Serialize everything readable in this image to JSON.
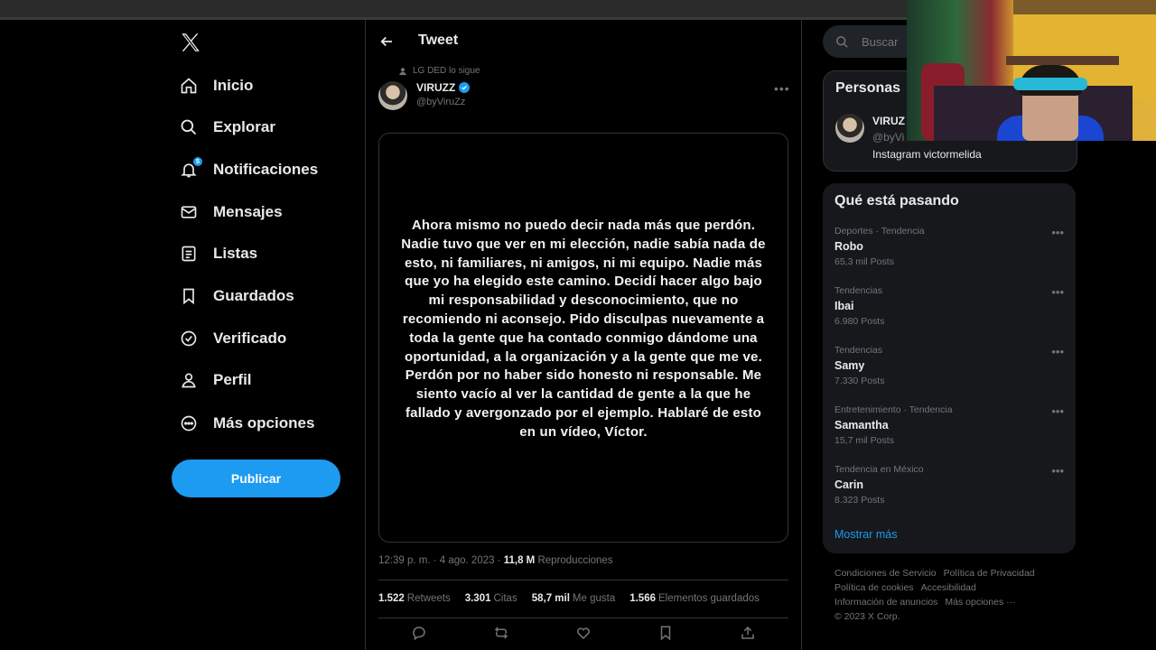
{
  "nav": {
    "items": [
      {
        "label": "Inicio",
        "icon": "home-icon"
      },
      {
        "label": "Explorar",
        "icon": "search-icon"
      },
      {
        "label": "Notificaciones",
        "icon": "bell-icon",
        "badge": "5"
      },
      {
        "label": "Mensajes",
        "icon": "mail-icon"
      },
      {
        "label": "Listas",
        "icon": "list-icon"
      },
      {
        "label": "Guardados",
        "icon": "bookmark-icon"
      },
      {
        "label": "Verificado",
        "icon": "verified-icon"
      },
      {
        "label": "Perfil",
        "icon": "person-icon"
      },
      {
        "label": "Más opciones",
        "icon": "more-circle-icon"
      }
    ],
    "publish_label": "Publicar"
  },
  "tweet": {
    "header_title": "Tweet",
    "followed_by": "LG DED lo sigue",
    "author_name": "VIRUZZ",
    "author_handle": "@byViruZz",
    "body": "Ahora mismo no puedo decir nada más que perdón. Nadie tuvo que ver en mi elección, nadie sabía nada de esto, ni familiares, ni amigos, ni mi equipo. Nadie más que yo ha elegido este camino. Decidí hacer algo bajo mi responsabilidad y desconocimiento, que no recomiendo ni aconsejo. Pido disculpas nuevamente a toda la gente que ha contado conmigo dándome una oportunidad, a la organización y a la gente que me ve. Perdón por no haber sido honesto ni responsable. Me siento vacío al ver la cantidad de gente a la que he fallado y avergonzado por el ejemplo. Hablaré de esto en un vídeo, Víctor.",
    "time": "12:39 p. m. · 4 ago. 2023 ·",
    "views_count": "11,8 M",
    "views_label": "Reproducciones",
    "stats": [
      {
        "value": "1.522",
        "label": "Retweets"
      },
      {
        "value": "3.301",
        "label": "Citas"
      },
      {
        "value": "58,7 mil",
        "label": "Me gusta"
      },
      {
        "value": "1.566",
        "label": "Elementos guardados"
      }
    ]
  },
  "sidebar": {
    "search_placeholder": "Buscar",
    "people_title": "Personas",
    "person": {
      "name": "VIRUZ",
      "handle": "@byVi",
      "bio": "Instagram victormelida"
    },
    "trends_title": "Qué está pasando",
    "trends": [
      {
        "category": "Deportes · Tendencia",
        "name": "Robo",
        "count": "65,3 mil Posts"
      },
      {
        "category": "Tendencias",
        "name": "Ibai",
        "count": "6.980 Posts"
      },
      {
        "category": "Tendencias",
        "name": "Samy",
        "count": "7.330 Posts"
      },
      {
        "category": "Entretenimiento · Tendencia",
        "name": "Samantha",
        "count": "15,7 mil Posts"
      },
      {
        "category": "Tendencia en México",
        "name": "Carin",
        "count": "8.323 Posts"
      }
    ],
    "show_more": "Mostrar más",
    "footer": [
      "Condiciones de Servicio",
      "Política de Privacidad",
      "Política de cookies",
      "Accesibilidad",
      "Información de anuncios",
      "Más opciones ···",
      "© 2023 X Corp."
    ]
  },
  "colors": {
    "accent": "#1d9bf0",
    "background": "#000000",
    "panel": "#16181c",
    "muted": "#71767b"
  }
}
